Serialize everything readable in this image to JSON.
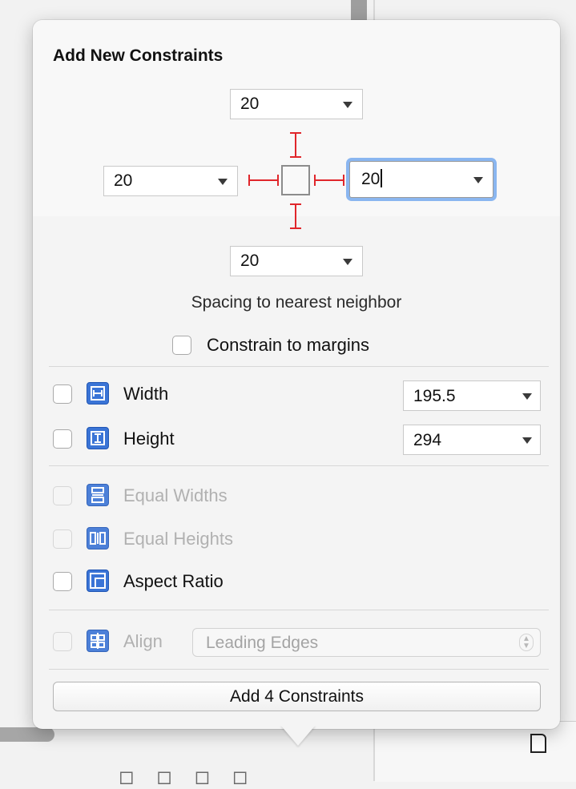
{
  "popover": {
    "title": "Add New Constraints",
    "spacing": {
      "top": "20",
      "left": "20",
      "right": "20",
      "bottom": "20",
      "caption": "Spacing to nearest neighbor"
    },
    "constrain_to_margins": {
      "label": "Constrain to margins",
      "checked": false
    },
    "size": {
      "width": {
        "label": "Width",
        "value": "195.5",
        "checked": false
      },
      "height": {
        "label": "Height",
        "value": "294",
        "checked": false
      }
    },
    "relations": {
      "equal_widths": {
        "label": "Equal Widths",
        "enabled": false
      },
      "equal_heights": {
        "label": "Equal Heights",
        "enabled": false
      },
      "aspect_ratio": {
        "label": "Aspect Ratio",
        "enabled": true
      }
    },
    "align": {
      "label": "Align",
      "selected": "Leading Edges",
      "enabled": false
    },
    "add_button": "Add 4 Constraints"
  },
  "colors": {
    "pin_red": "#e0262b",
    "icon_blue": "#3a74d6",
    "focus_ring": "#8ab6f0"
  },
  "icons": {
    "width": "width-constraint-icon",
    "height": "height-constraint-icon",
    "equal_widths": "equal-widths-icon",
    "equal_heights": "equal-heights-icon",
    "aspect_ratio": "aspect-ratio-icon",
    "align": "align-icon",
    "document": "document-icon"
  }
}
